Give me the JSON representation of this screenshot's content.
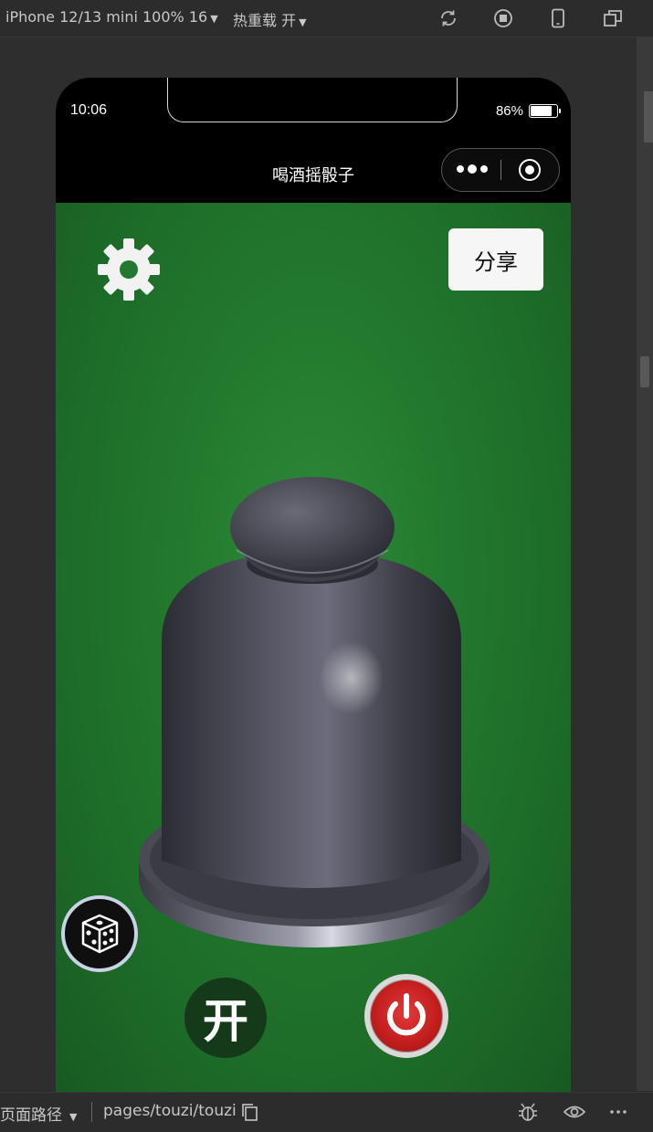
{
  "ide": {
    "device_selector": "iPhone 12/13 mini 100% 16",
    "hot_reload": "热重载 开",
    "toolbar_icons": [
      "refresh-icon",
      "stop-icon",
      "phone-icon",
      "window-icon"
    ],
    "page_path_label": "页面路径",
    "page_path": "pages/touzi/touzi",
    "bottom_icons": [
      "copy-icon",
      "bug-icon",
      "eye-icon",
      "more-icon"
    ]
  },
  "phone": {
    "time": "10:06",
    "battery": "86%",
    "battery_level": 0.86,
    "nav_title": "喝酒摇骰子"
  },
  "game": {
    "share_label": "分享",
    "open_label": "开",
    "icons": [
      "gear-icon",
      "dice-cup",
      "dice-icon",
      "power-icon"
    ]
  },
  "colors": {
    "felt": "#237a2e",
    "power": "#c41e1e",
    "open_button": "#143a1a"
  }
}
